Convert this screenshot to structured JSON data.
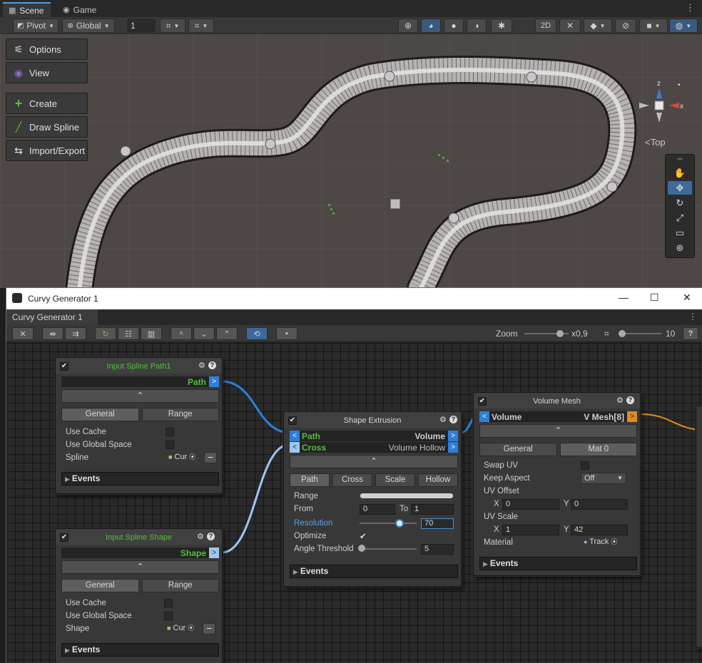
{
  "scene": {
    "tabs": [
      {
        "label": "Scene"
      },
      {
        "label": "Game"
      }
    ],
    "toolbar": {
      "pivot": "Pivot",
      "global": "Global",
      "grid_value": "1",
      "mode_2d": "2D"
    },
    "overlay_buttons": {
      "options": "Options",
      "view": "View",
      "create": "Create",
      "draw_spline": "Draw Spline",
      "import_export": "Import/Export"
    },
    "gizmo": {
      "label": "Top",
      "x_axis": "x",
      "z_axis": "z"
    }
  },
  "generator": {
    "window_title": "Curvy Generator 1",
    "tab_title": "Curvy Generator 1",
    "zoom_label": "Zoom",
    "zoom_value": "x0,9",
    "grid_value": "10",
    "colors": {
      "accent_blue": "#2f7fd8",
      "output_orange": "#e08a20",
      "title_green": "#4fc03a"
    },
    "nodes": {
      "input_path": {
        "title": "Input Spline Path1",
        "output_slot": "Path",
        "tabs": [
          "General",
          "Range"
        ],
        "use_cache_label": "Use Cache",
        "use_global_space_label": "Use Global Space",
        "spline_label": "Spline",
        "spline_value": "Cur",
        "events_label": "Events"
      },
      "input_shape": {
        "title": "Input Spline Shape",
        "output_slot": "Shape",
        "tabs": [
          "General",
          "Range"
        ],
        "use_cache_label": "Use Cache",
        "use_global_space_label": "Use Global Space",
        "shape_label": "Shape",
        "shape_value": "Cur",
        "events_label": "Events"
      },
      "extrusion": {
        "title": "Shape Extrusion",
        "in_path": "Path",
        "in_cross": "Cross",
        "out_volume": "Volume",
        "out_hollow": "Volume Hollow",
        "tabs": [
          "Path",
          "Cross",
          "Scale",
          "Hollow"
        ],
        "range_label": "Range",
        "from_label": "From",
        "from_value": "0",
        "to_label": "To",
        "to_value": "1",
        "resolution_label": "Resolution",
        "resolution_value": "70",
        "resolution_fraction": 0.7,
        "optimize_label": "Optimize",
        "angle_label": "Angle Threshold",
        "angle_value": "5",
        "angle_fraction": 0.05,
        "events_label": "Events"
      },
      "volume_mesh": {
        "title": "Volume Mesh",
        "in_volume": "Volume",
        "out_mesh": "V Mesh[8]",
        "tabs": [
          "General",
          "Mat 0"
        ],
        "swap_uv_label": "Swap UV",
        "keep_aspect_label": "Keep Aspect",
        "keep_aspect_value": "Off",
        "uv_offset_label": "UV Offset",
        "uv_offset_x": "0",
        "uv_offset_y": "0",
        "uv_scale_label": "UV Scale",
        "uv_scale_x": "1",
        "uv_scale_y": "42",
        "x_label": "X",
        "y_label": "Y",
        "material_label": "Material",
        "material_value": "Track",
        "events_label": "Events"
      }
    }
  }
}
